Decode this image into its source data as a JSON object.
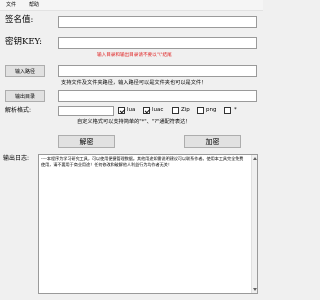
{
  "menu": {
    "file": "文件",
    "help": "帮助"
  },
  "sign": {
    "label": "签名值:",
    "value": ""
  },
  "key": {
    "label": "密钥KEY:",
    "value": ""
  },
  "hint_red": "输入目录和输出目录请不要以\"\\\"结尾",
  "input_path": {
    "button": "输入路径",
    "value": ""
  },
  "hint_support": "支持文件及文件夹路径，输入路径可以是文件夹也可以是文件！",
  "output_dir": {
    "button": "输出目录",
    "value": ""
  },
  "parse": {
    "label": "解析格式:",
    "custom_value": "",
    "options": [
      {
        "label": "lua",
        "checked": true
      },
      {
        "label": "luac",
        "checked": true
      },
      {
        "label": "Zip",
        "checked": false
      },
      {
        "label": "png",
        "checked": false
      },
      {
        "label": "*",
        "checked": false
      }
    ]
  },
  "hint_custom": "自定义格式可以支持简单的\"*\"、\"?\"通配符表达！",
  "actions": {
    "decrypt": "解密",
    "encrypt": "加密"
  },
  "log": {
    "label": "输出日志:",
    "text": "----本程序为学习研究工具，可以使用便捷管理数据。其他用途如需说明建议可以联系作者。使用本工具完全免费使用，请不要用于商业用途！任何修改和破解他人利益行为均作者无关！"
  }
}
